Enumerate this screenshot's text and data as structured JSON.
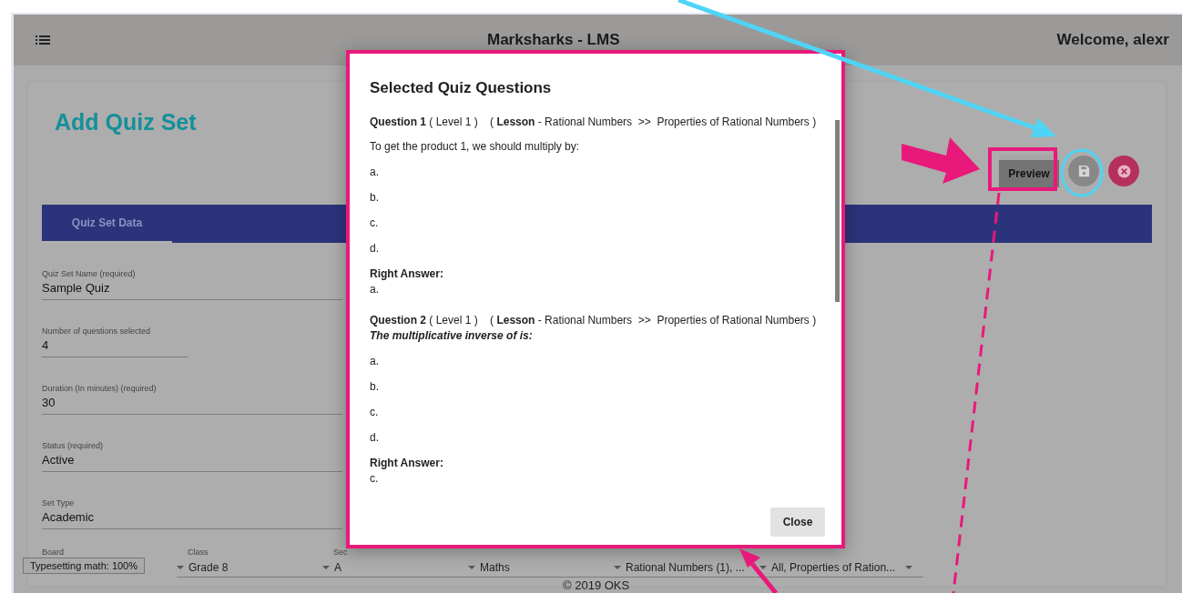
{
  "app": {
    "title": "Marksharks - LMS",
    "welcome": "Welcome, alexr"
  },
  "page": {
    "title": "Add Quiz Set",
    "actions": [
      {
        "kind": "text",
        "label": "Preview"
      },
      {
        "kind": "save"
      },
      {
        "kind": "cancel"
      }
    ]
  },
  "tabs": [
    {
      "label": "Quiz Set Data",
      "selected": true
    }
  ],
  "fields": [
    {
      "label": "Quiz Set Name (required)",
      "value": "Sample Quiz"
    },
    {
      "label": "Number of questions selected",
      "value": "4"
    },
    {
      "label": "Duration (In minutes) (required)",
      "value": "30"
    },
    {
      "label": "Status (required)",
      "value": "Active"
    },
    {
      "label": "Set Type",
      "value": "Academic"
    }
  ],
  "filters": [
    {
      "label": "Board"
    },
    {
      "label": "Class",
      "value": "Grade 8"
    },
    {
      "label": "Sec",
      "value": "A"
    },
    {
      "value": "Maths"
    },
    {
      "value": "Rational Numbers (1), ..."
    },
    {
      "value": "All, Properties of Ration..."
    }
  ],
  "status_badge": "Typesetting math: 100%",
  "footer": "© 2019 OKS",
  "dialog": {
    "title": "Selected Quiz Questions",
    "questions": [
      {
        "heading": "**Question 1** ( Level 1 )    ( **Lesson** - Rational Numbers  >>  Properties of Rational Numbers )",
        "text": "To get the product 1, we should multiply by:",
        "kind": "plain",
        "options": [
          "a.",
          "b.",
          "c.",
          "d."
        ],
        "answer_label": "Right Answer:",
        "answer": "a."
      },
      {
        "heading": "**Question 2** ( Level 1 )    ( **Lesson** - Rational Numbers  >>  Properties of Rational Numbers )",
        "text": "The multiplicative inverse of is:",
        "kind": "emphasis",
        "options": [
          "a.",
          "b.",
          "c.",
          "d."
        ],
        "answer_label": "Right Answer:",
        "answer": "c."
      }
    ],
    "close": "Close"
  }
}
